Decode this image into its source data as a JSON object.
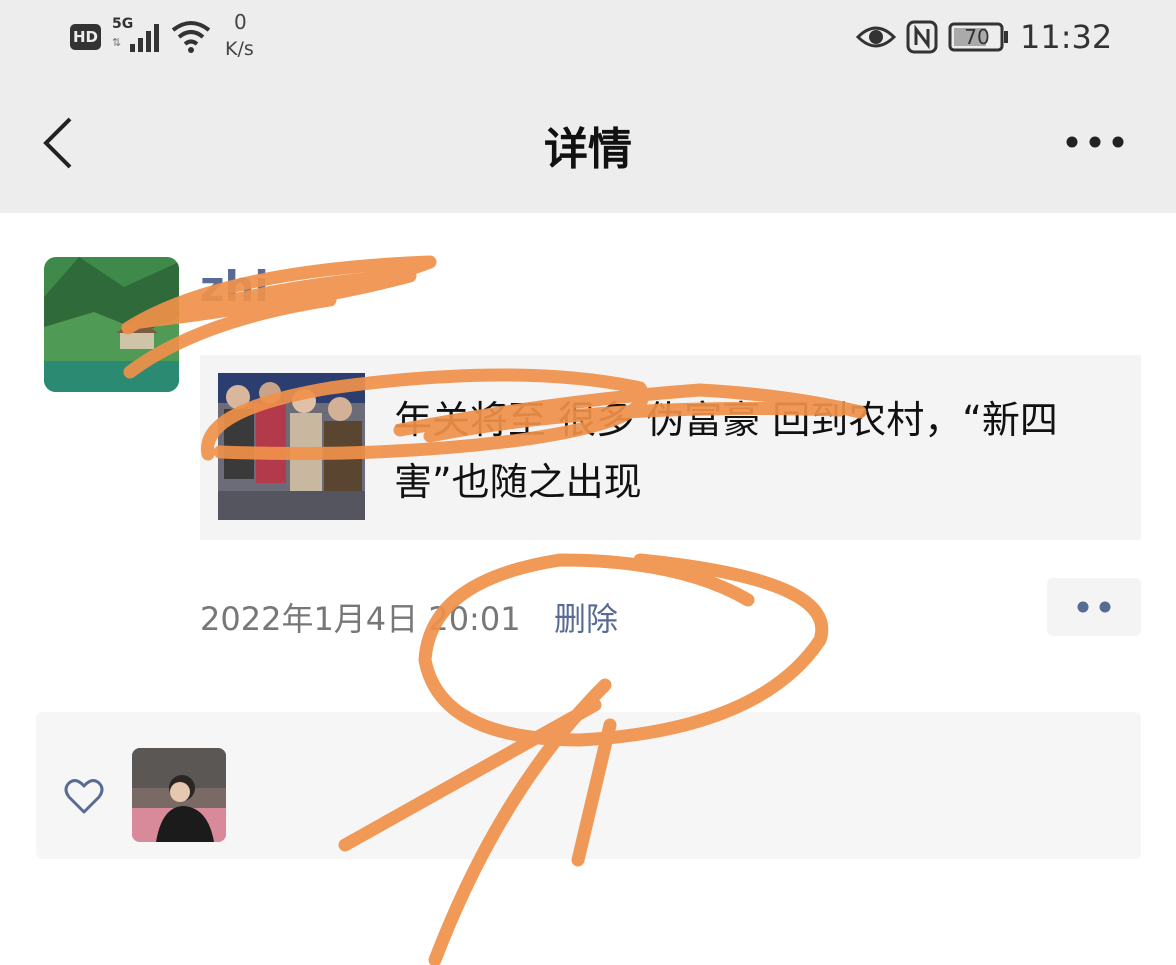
{
  "status_bar": {
    "hd_badge": "HD",
    "network": "5G",
    "speed_value": "0",
    "speed_unit": "K/s",
    "battery": "70",
    "time": "11:32",
    "icons": [
      "signal-icon",
      "wifi-icon",
      "eye-icon",
      "nfc-icon",
      "battery-icon"
    ]
  },
  "nav": {
    "back_icon": "chevron-left-icon",
    "title": "详情",
    "more_icon": "more-dots-icon"
  },
  "post": {
    "username": "zhi",
    "link": {
      "title": "年关将至 很多 伪富豪 回到农村，“新四害”也随之出现"
    },
    "time": "2022年1月4日 20:01",
    "delete_label": "删除",
    "action_icon": "comment-dots-icon"
  },
  "likes": {
    "icon": "heart-icon"
  },
  "colors": {
    "link_blue": "#576b95",
    "header_bg": "#ededed",
    "card_bg": "#f4f4f4",
    "scribble": "#f0914a"
  }
}
